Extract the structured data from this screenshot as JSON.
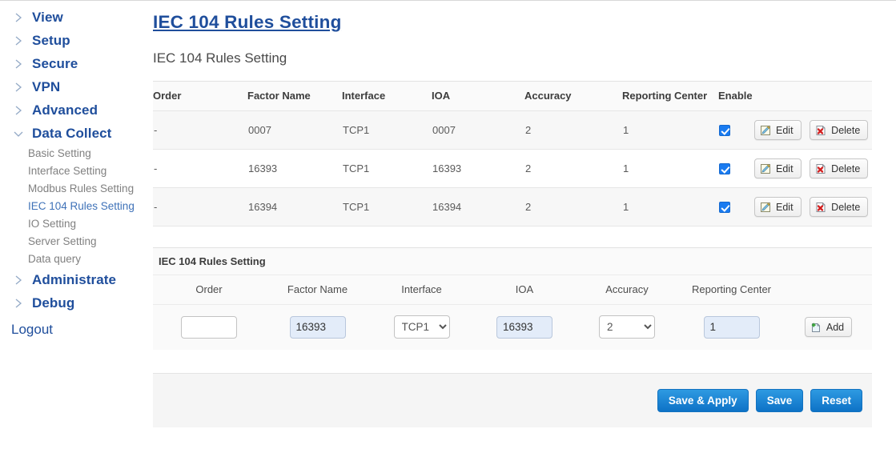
{
  "sidebar": {
    "top_items": [
      {
        "label": "View",
        "expanded": false
      },
      {
        "label": "Setup",
        "expanded": false
      },
      {
        "label": "Secure",
        "expanded": false
      },
      {
        "label": "VPN",
        "expanded": false
      },
      {
        "label": "Advanced",
        "expanded": false
      },
      {
        "label": "Data Collect",
        "expanded": true
      }
    ],
    "sub_items": [
      {
        "label": "Basic Setting",
        "active": false
      },
      {
        "label": "Interface Setting",
        "active": false
      },
      {
        "label": "Modbus Rules Setting",
        "active": false
      },
      {
        "label": "IEC 104 Rules Setting",
        "active": true
      },
      {
        "label": "IO Setting",
        "active": false
      },
      {
        "label": "Server Setting",
        "active": false
      },
      {
        "label": "Data query",
        "active": false
      }
    ],
    "tail_items": [
      {
        "label": "Administrate",
        "expanded": false
      },
      {
        "label": "Debug",
        "expanded": false
      }
    ],
    "logout_label": "Logout"
  },
  "main": {
    "page_title": "IEC 104 Rules Setting",
    "section_title": "IEC 104 Rules Setting"
  },
  "list_table": {
    "headers": [
      "Order",
      "Factor Name",
      "Interface",
      "IOA",
      "Accuracy",
      "Reporting Center",
      "Enable",
      ""
    ],
    "rows": [
      {
        "order": "-",
        "factor_name": "0007",
        "interface": "TCP1",
        "ioa": "0007",
        "accuracy": "2",
        "reporting_center": "1",
        "enabled": true,
        "edit_label": "Edit",
        "delete_label": "Delete"
      },
      {
        "order": "-",
        "factor_name": "16393",
        "interface": "TCP1",
        "ioa": "16393",
        "accuracy": "2",
        "reporting_center": "1",
        "enabled": true,
        "edit_label": "Edit",
        "delete_label": "Delete"
      },
      {
        "order": "-",
        "factor_name": "16394",
        "interface": "TCP1",
        "ioa": "16394",
        "accuracy": "2",
        "reporting_center": "1",
        "enabled": true,
        "edit_label": "Edit",
        "delete_label": "Delete"
      }
    ]
  },
  "form": {
    "panel_title": "IEC 104 Rules Setting",
    "headers": [
      "Order",
      "Factor Name",
      "Interface",
      "IOA",
      "Accuracy",
      "Reporting Center"
    ],
    "order_value": "",
    "order_placeholder": "",
    "factor_name_value": "16393",
    "interface_value": "TCP1",
    "interface_options": [
      "TCP1"
    ],
    "ioa_value": "16393",
    "accuracy_value": "2",
    "accuracy_options": [
      "2"
    ],
    "reporting_center_value": "1",
    "add_label": "Add"
  },
  "footer": {
    "save_apply_label": "Save & Apply",
    "save_label": "Save",
    "reset_label": "Reset"
  },
  "colors": {
    "nav_blue": "#1f4e9c",
    "active_sub": "#3f72b8",
    "button_blue": "#0d72c6",
    "checkbox_blue": "#1a7bf0"
  }
}
